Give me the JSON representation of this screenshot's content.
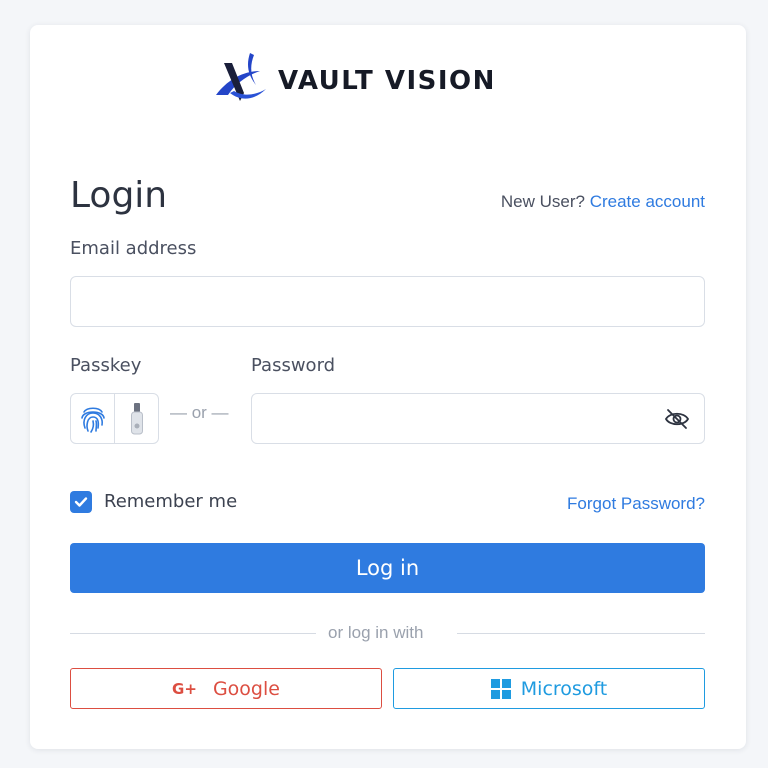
{
  "brand": {
    "name": "VAULT VISION"
  },
  "login": {
    "title": "Login",
    "new_user_text": "New User?",
    "create_account_link": "Create account",
    "email_label": "Email address",
    "email_value": "",
    "passkey_label": "Passkey",
    "or_text": "— or —",
    "password_label": "Password",
    "password_value": "",
    "remember_me_label": "Remember me",
    "remember_me_checked": true,
    "forgot_password_link": "Forgot Password?",
    "login_button": "Log in",
    "divider_text": "or log in with"
  },
  "social": {
    "google_label": "Google",
    "google_icon": "G+",
    "microsoft_label": "Microsoft"
  },
  "colors": {
    "accent": "#2f7be0",
    "google": "#dc4e41",
    "microsoft": "#1f9be0"
  }
}
